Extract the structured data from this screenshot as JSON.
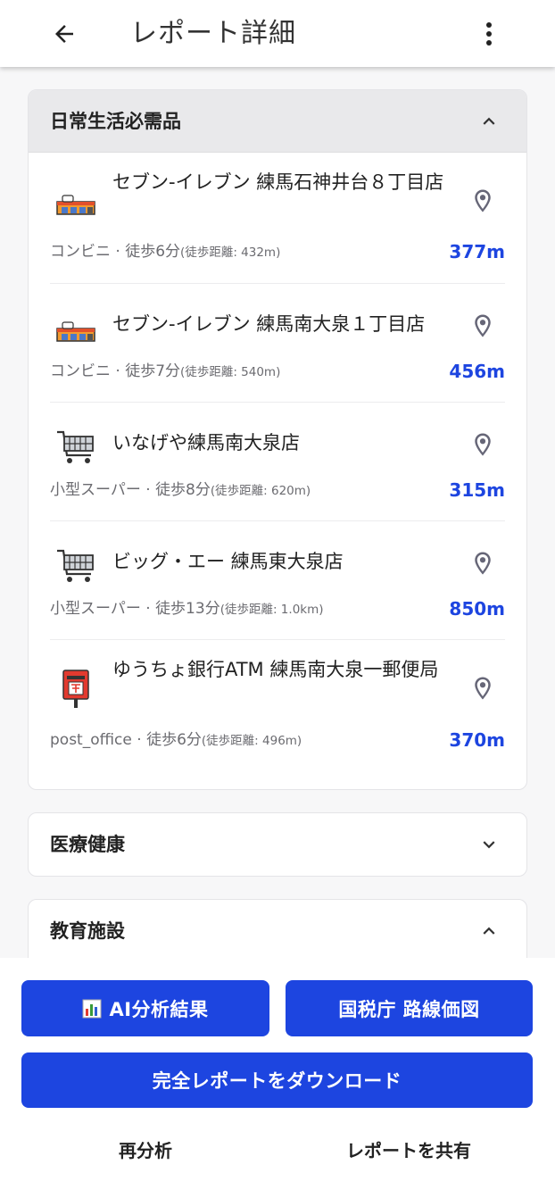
{
  "header": {
    "title": "レポート詳細"
  },
  "sections": [
    {
      "title": "日常生活必需品",
      "expanded": true,
      "items": [
        {
          "name": "セブン-イレブン 練馬石神井台８丁目店",
          "category": "コンビニ",
          "walk": "徒歩6分",
          "walk_distance": "(徒歩距離: 432m)",
          "distance": "377m",
          "icon": "convenience-store-icon"
        },
        {
          "name": "セブン-イレブン 練馬南大泉１丁目店",
          "category": "コンビニ",
          "walk": "徒歩7分",
          "walk_distance": "(徒歩距離: 540m)",
          "distance": "456m",
          "icon": "convenience-store-icon"
        },
        {
          "name": "いなげや練馬南大泉店",
          "category": "小型スーパー",
          "walk": "徒歩8分",
          "walk_distance": "(徒歩距離: 620m)",
          "distance": "315m",
          "icon": "shopping-cart-icon"
        },
        {
          "name": "ビッグ・エー 練馬東大泉店",
          "category": "小型スーパー",
          "walk": "徒歩13分",
          "walk_distance": "(徒歩距離: 1.0km)",
          "distance": "850m",
          "icon": "shopping-cart-icon"
        },
        {
          "name": "ゆうちょ銀行ATM 練馬南大泉一郵便局",
          "category": "post_office",
          "walk": "徒歩6分",
          "walk_distance": "(徒歩距離: 496m)",
          "distance": "370m",
          "icon": "postbox-icon"
        }
      ]
    },
    {
      "title": "医療健康",
      "expanded": false
    },
    {
      "title": "教育施設",
      "expanded": true
    }
  ],
  "actions": {
    "ai_analysis": "AI分析結果",
    "route_price_map": "国税庁 路線価図",
    "download": "完全レポートをダウンロード",
    "reanalyze": "再分析",
    "share": "レポートを共有"
  },
  "colors": {
    "primary": "#1d45e0",
    "distance": "#1d45e0",
    "header_bg": "#e9e9eb"
  }
}
